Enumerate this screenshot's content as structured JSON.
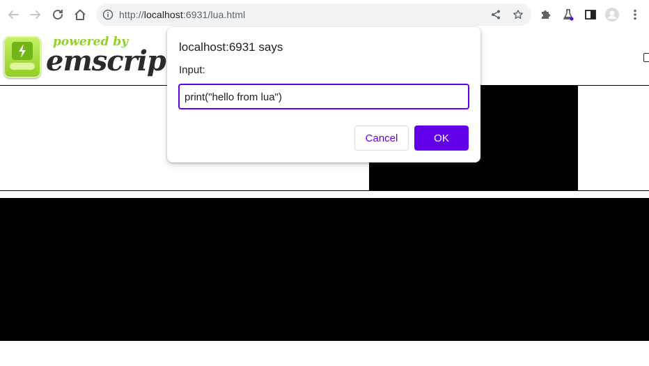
{
  "browser": {
    "url_scheme_prefix": "http://",
    "url_host": "localhost",
    "url_rest": ":6931/lua.html",
    "icons": {
      "back": "arrow-left-icon",
      "forward": "arrow-right-icon",
      "reload": "reload-icon",
      "home": "home-icon",
      "site_info": "info-icon",
      "share": "share-icon",
      "bookmark": "star-icon",
      "extensions": "puzzle-icon",
      "labs": "flask-icon",
      "side_panel": "side-panel-icon",
      "profile": "avatar-icon",
      "menu": "more-vert-icon"
    }
  },
  "page": {
    "logo_powered": "powered by",
    "logo_word": "emscripten"
  },
  "dialog": {
    "title": "localhost:6931 says",
    "label": "Input:",
    "input_value": "print(\"hello from lua\")",
    "cancel_label": "Cancel",
    "ok_label": "OK",
    "accent": "#6200ea"
  }
}
